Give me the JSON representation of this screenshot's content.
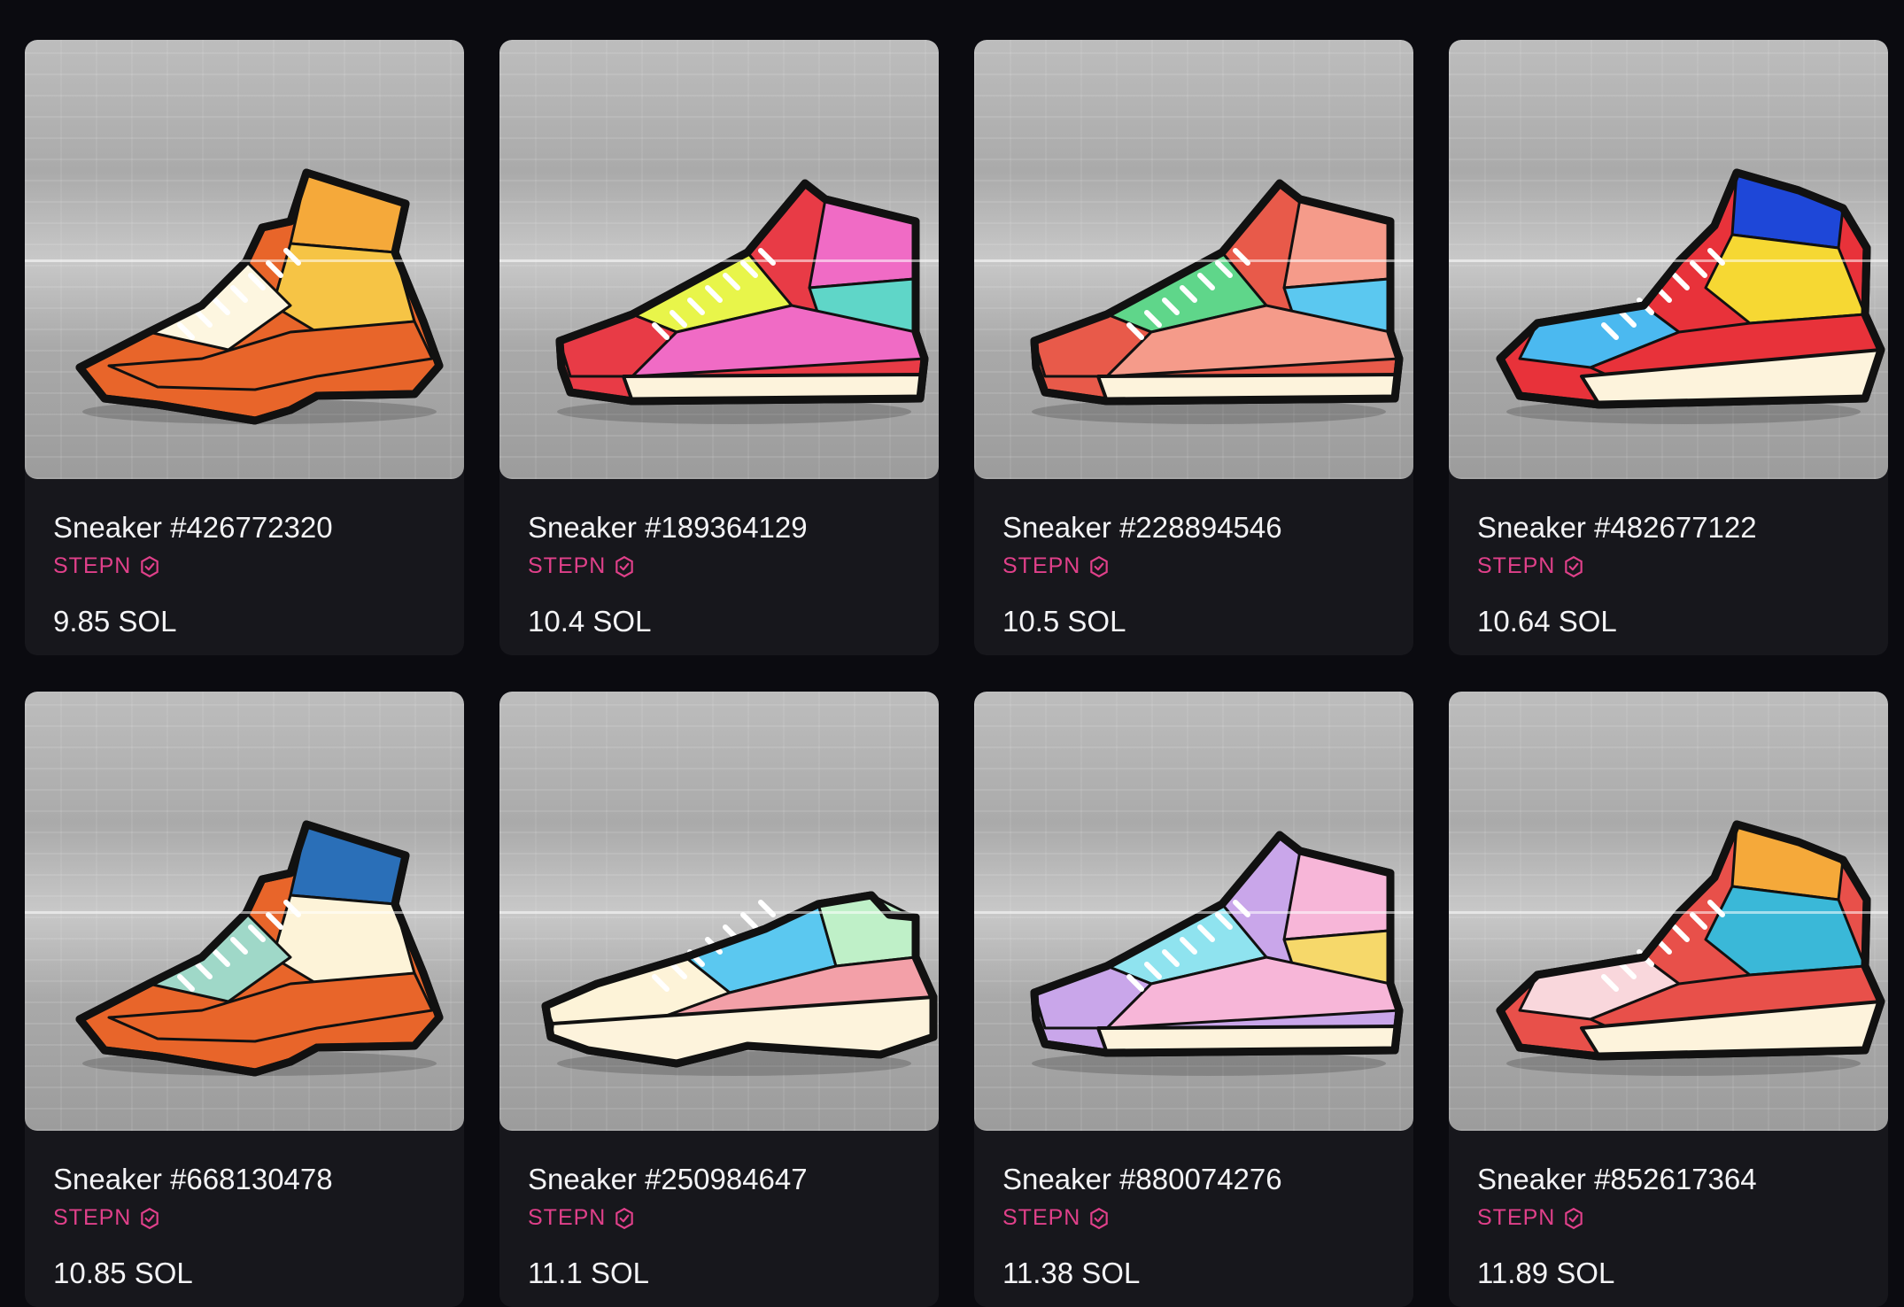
{
  "listings": [
    {
      "name": "Sneaker #426772320",
      "collection": "STEPN",
      "price": "9.85 SOL",
      "shoe_style": "runner-high",
      "colors": [
        "#e8652a",
        "#f5a93a",
        "#f6c445",
        "#fdf6e0"
      ]
    },
    {
      "name": "Sneaker #189364129",
      "collection": "STEPN",
      "price": "10.4 SOL",
      "shoe_style": "high-top",
      "colors": [
        "#e83b46",
        "#f06bc5",
        "#5fd6c8",
        "#e8f54a"
      ]
    },
    {
      "name": "Sneaker #228894546",
      "collection": "STEPN",
      "price": "10.5 SOL",
      "shoe_style": "high-top",
      "colors": [
        "#e85a4a",
        "#f59b8a",
        "#5bc8f0",
        "#5fd68a"
      ]
    },
    {
      "name": "Sneaker #482677122",
      "collection": "STEPN",
      "price": "10.64 SOL",
      "shoe_style": "basketball",
      "colors": [
        "#e8323a",
        "#1e47d8",
        "#f6d833",
        "#4bb9f0"
      ]
    },
    {
      "name": "Sneaker #668130478",
      "collection": "STEPN",
      "price": "10.85 SOL",
      "shoe_style": "runner-high",
      "colors": [
        "#e8652a",
        "#2a6fb8",
        "#fdf3d8",
        "#9fd8c8"
      ]
    },
    {
      "name": "Sneaker #250984647",
      "collection": "STEPN",
      "price": "11.1 SOL",
      "shoe_style": "low-runner",
      "colors": [
        "#f3a0a8",
        "#5bc8f0",
        "#bff0c8",
        "#fdf3d8"
      ]
    },
    {
      "name": "Sneaker #880074276",
      "collection": "STEPN",
      "price": "11.38 SOL",
      "shoe_style": "high-top",
      "colors": [
        "#c9a6ea",
        "#f7b6d8",
        "#f6d86a",
        "#8fe3ef"
      ]
    },
    {
      "name": "Sneaker #852617364",
      "collection": "STEPN",
      "price": "11.89 SOL",
      "shoe_style": "basketball",
      "colors": [
        "#e8504a",
        "#f5a93a",
        "#3ab8d8",
        "#f9d7dc"
      ]
    }
  ],
  "icons": {
    "verified": "verified-badge-icon",
    "bolt": "lightning-icon"
  },
  "theme": {
    "background": "#0b0b10",
    "card": "#17171c",
    "accent": "#e0408a",
    "text": "#f4f4f6"
  }
}
